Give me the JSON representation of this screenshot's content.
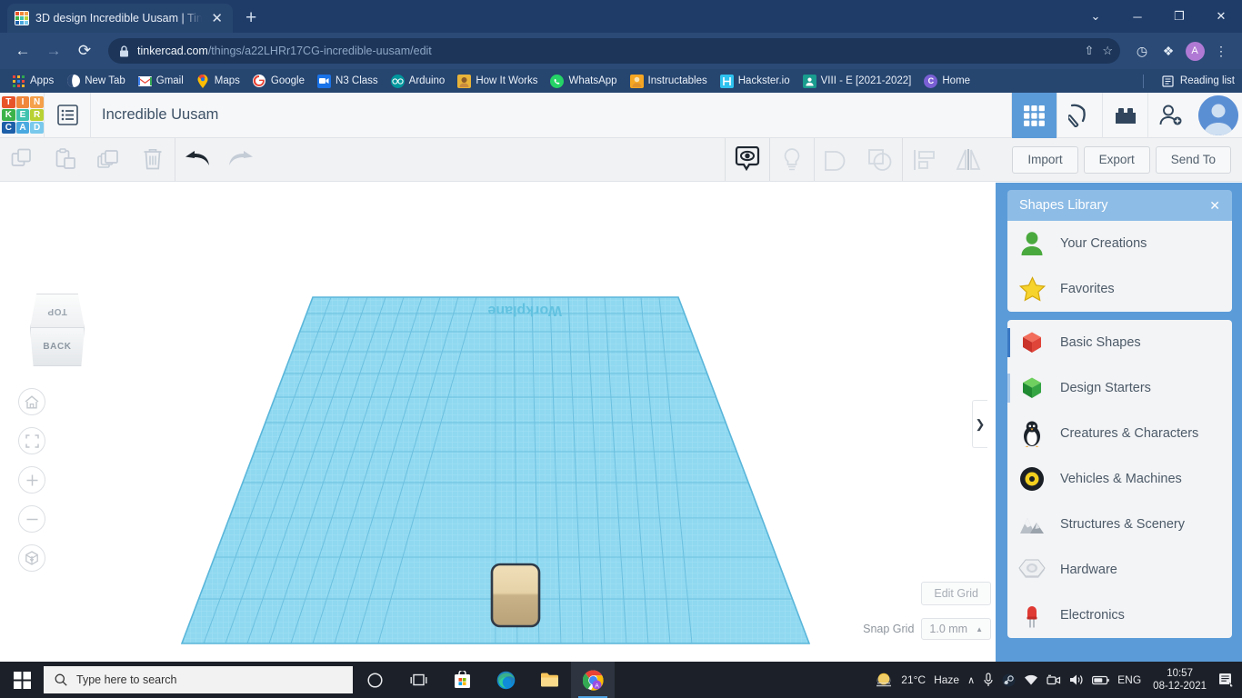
{
  "browser": {
    "tab": {
      "title": "3D design Incredible Uusam | Tin",
      "favicon": "tinkercad-favicon",
      "close_label": "✕"
    },
    "new_tab_label": "+",
    "window_controls": [
      {
        "name": "minimize-to-tray-chevron",
        "glyph": "⌄"
      },
      {
        "name": "minimize",
        "glyph": "─"
      },
      {
        "name": "maximize",
        "glyph": "❐"
      },
      {
        "name": "close",
        "glyph": "✕"
      }
    ],
    "nav": {
      "back": "←",
      "forward": "→",
      "reload": "⟳",
      "lock_icon": "🔒"
    },
    "url": {
      "domain": "tinkercad.com",
      "path": "/things/a22LHRr17CG-incredible-uusam/edit"
    },
    "omnibox_icons": [
      {
        "name": "share-icon",
        "glyph": "⇧"
      },
      {
        "name": "bookmark-star-icon",
        "glyph": "☆"
      }
    ],
    "toolbar_icons": [
      {
        "name": "history-clock-icon",
        "glyph": "◷"
      },
      {
        "name": "extensions-puzzle-icon",
        "glyph": "❖"
      }
    ],
    "profile_initial": "A",
    "menu_glyph": "⋮",
    "bookmarks": [
      {
        "label": "Apps",
        "icon": "apps-grid-icon",
        "color": "#ffffff"
      },
      {
        "label": "New Tab",
        "icon": "globe-icon",
        "color": "#ffffff"
      },
      {
        "label": "Gmail",
        "icon": "gmail-icon",
        "color": "#ffffff"
      },
      {
        "label": "Maps",
        "icon": "maps-pin-icon",
        "color": "#ffffff"
      },
      {
        "label": "Google",
        "icon": "google-g-icon",
        "color": "#ffffff"
      },
      {
        "label": "N3 Class",
        "icon": "video-camera-icon",
        "color": "#1a73e8"
      },
      {
        "label": "Arduino",
        "icon": "arduino-infinity-icon",
        "color": "#00979d"
      },
      {
        "label": "How It Works",
        "icon": "howitworks-icon",
        "color": "#e8b339"
      },
      {
        "label": "WhatsApp",
        "icon": "whatsapp-icon",
        "color": "#25d366"
      },
      {
        "label": "Instructables",
        "icon": "instructables-icon",
        "color": "#f5a623"
      },
      {
        "label": "Hackster.io",
        "icon": "hackster-icon",
        "color": "#2fc2ef"
      },
      {
        "label": "VIII - E [2021-2022]",
        "icon": "classroom-person-icon",
        "color": "#1a9c8e"
      },
      {
        "label": "Home",
        "icon": "letter-c-icon",
        "color": "#7a5fd4"
      }
    ],
    "reading_list": {
      "label": "Reading list",
      "icon": "reading-list-icon"
    }
  },
  "tinkercad": {
    "logo_tiles": [
      {
        "letter": "T",
        "color": "#e8542a"
      },
      {
        "letter": "I",
        "color": "#f0873a"
      },
      {
        "letter": "N",
        "color": "#f5a04a"
      },
      {
        "letter": "K",
        "color": "#3cb34a"
      },
      {
        "letter": "E",
        "color": "#3fc2b0"
      },
      {
        "letter": "R",
        "color": "#b8d133"
      },
      {
        "letter": "C",
        "color": "#1d5fa8"
      },
      {
        "letter": "A",
        "color": "#4aa9e0"
      },
      {
        "letter": "D",
        "color": "#79c9ec"
      }
    ],
    "menu_icon": "hamburger-list-icon",
    "document_title": "Incredible Uusam",
    "header_buttons": [
      {
        "name": "blocks-grid-button",
        "icon": "grid-9-squares-icon",
        "active": true
      },
      {
        "name": "codeblocks-button",
        "icon": "pickaxe-icon",
        "active": false
      },
      {
        "name": "blocks-button",
        "icon": "brick-block-icon",
        "active": false
      },
      {
        "name": "invite-people-button",
        "icon": "person-add-icon",
        "active": false
      }
    ],
    "avatar": {
      "name": "user-avatar",
      "icon": "person-silhouette-icon"
    },
    "toolbar_left": [
      {
        "name": "copy-button",
        "icon": "copy-icon",
        "enabled": false
      },
      {
        "name": "paste-button",
        "icon": "paste-clipboard-icon",
        "enabled": false
      },
      {
        "name": "duplicate-button",
        "icon": "duplicate-layers-icon",
        "enabled": false
      },
      {
        "name": "delete-button",
        "icon": "trash-can-icon",
        "enabled": false
      },
      {
        "name": "undo-button",
        "icon": "undo-arrow-icon",
        "enabled": true
      },
      {
        "name": "redo-button",
        "icon": "redo-arrow-icon",
        "enabled": false
      }
    ],
    "toolbar_mid": [
      {
        "name": "show-hide-button",
        "icon": "eye-in-bubble-icon",
        "enabled": true
      },
      {
        "name": "light-button",
        "icon": "lightbulb-icon",
        "enabled": false
      },
      {
        "name": "group-button",
        "icon": "group-shapes-icon",
        "enabled": false
      },
      {
        "name": "ungroup-button",
        "icon": "ungroup-shapes-icon",
        "enabled": false
      },
      {
        "name": "align-button",
        "icon": "align-icon",
        "enabled": false
      },
      {
        "name": "mirror-button",
        "icon": "mirror-flip-icon",
        "enabled": false
      }
    ],
    "actions": [
      {
        "name": "import-button",
        "label": "Import"
      },
      {
        "name": "export-button",
        "label": "Export"
      },
      {
        "name": "send-to-button",
        "label": "Send To"
      }
    ],
    "viewcube": {
      "top_face": "TOP",
      "front_face": "BACK"
    },
    "view_controls": [
      {
        "name": "home-view-button",
        "icon": "home-icon"
      },
      {
        "name": "fit-to-view-button",
        "icon": "fit-brackets-icon"
      },
      {
        "name": "zoom-in-button",
        "icon": "plus-icon"
      },
      {
        "name": "zoom-out-button",
        "icon": "minus-icon"
      },
      {
        "name": "perspective-toggle-button",
        "icon": "cube-orthographic-icon"
      }
    ],
    "workplane": {
      "label": "Workplane",
      "grid_color": "#7dd0ec",
      "object": {
        "name": "rounded-box-shape",
        "color": "#ddc79a"
      }
    },
    "grid_controls": {
      "edit_grid_label": "Edit Grid",
      "snap_grid_label": "Snap Grid",
      "snap_grid_value": "1.0 mm",
      "snap_caret": "▲"
    },
    "collapse_handle": "❯",
    "panel": {
      "title": "Shapes Library",
      "close": "✕",
      "groups": [
        {
          "items": [
            {
              "label": "Your Creations",
              "icon": "person-green-icon",
              "accent": null
            },
            {
              "label": "Favorites",
              "icon": "star-yellow-icon",
              "accent": null
            }
          ]
        },
        {
          "items": [
            {
              "label": "Basic Shapes",
              "icon": "red-cube-icon",
              "accent": "#3b78c4"
            },
            {
              "label": "Design Starters",
              "icon": "green-cube-icon",
              "accent": "#a9c8e8"
            },
            {
              "label": "Creatures & Characters",
              "icon": "penguin-icon",
              "accent": null
            },
            {
              "label": "Vehicles & Machines",
              "icon": "tire-wheel-icon",
              "accent": null
            },
            {
              "label": "Structures & Scenery",
              "icon": "rocks-mountain-icon",
              "accent": null
            },
            {
              "label": "Hardware",
              "icon": "hex-nut-icon",
              "accent": null
            },
            {
              "label": "Electronics",
              "icon": "red-led-icon",
              "accent": null
            }
          ]
        }
      ]
    }
  },
  "taskbar": {
    "start_icon": "windows-logo-icon",
    "search_placeholder": "Type here to search",
    "search_icon": "magnifier-icon",
    "apps": [
      {
        "name": "cortana-button",
        "icon": "cortana-circle-icon",
        "active": false
      },
      {
        "name": "task-view-button",
        "icon": "task-view-icon",
        "active": false
      },
      {
        "name": "microsoft-store-button",
        "icon": "store-bag-icon",
        "active": false
      },
      {
        "name": "edge-button",
        "icon": "edge-icon",
        "active": false
      },
      {
        "name": "file-explorer-button",
        "icon": "folder-icon",
        "active": false
      },
      {
        "name": "chrome-button",
        "icon": "chrome-icon",
        "active": true
      }
    ],
    "weather": {
      "temp": "21°C",
      "condition": "Haze",
      "icon": "haze-sun-icon"
    },
    "tray": [
      {
        "name": "show-hidden-icons",
        "icon": "chevron-up-icon",
        "glyph": "∧"
      },
      {
        "name": "microphone-icon",
        "glyph": "🎙"
      },
      {
        "name": "steam-icon",
        "glyph": "●"
      },
      {
        "name": "wifi-icon",
        "glyph": "◠"
      },
      {
        "name": "camera-icon",
        "glyph": "▭"
      },
      {
        "name": "volume-icon",
        "glyph": "🔊"
      },
      {
        "name": "battery-icon",
        "glyph": "▬"
      }
    ],
    "language": "ENG",
    "time": "10:57",
    "date": "08-12-2021",
    "notification_icon": "notification-center-icon"
  }
}
